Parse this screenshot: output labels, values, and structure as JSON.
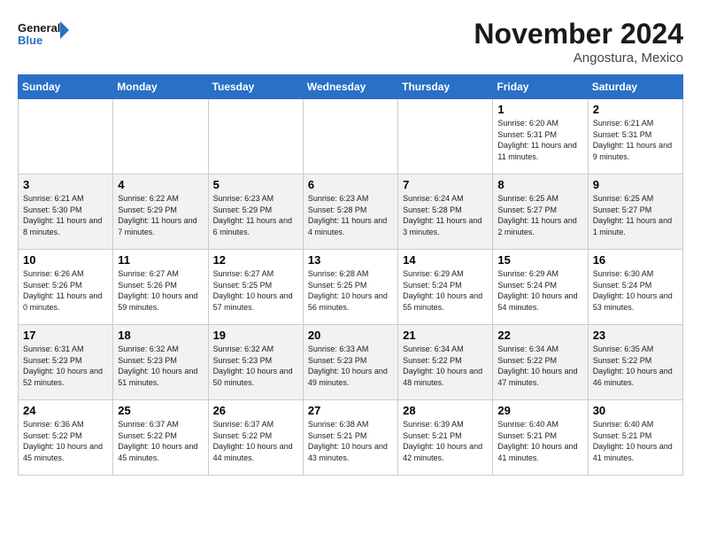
{
  "logo": {
    "line1": "General",
    "line2": "Blue"
  },
  "title": "November 2024",
  "location": "Angostura, Mexico",
  "days_of_week": [
    "Sunday",
    "Monday",
    "Tuesday",
    "Wednesday",
    "Thursday",
    "Friday",
    "Saturday"
  ],
  "weeks": [
    [
      {
        "day": "",
        "info": ""
      },
      {
        "day": "",
        "info": ""
      },
      {
        "day": "",
        "info": ""
      },
      {
        "day": "",
        "info": ""
      },
      {
        "day": "",
        "info": ""
      },
      {
        "day": "1",
        "info": "Sunrise: 6:20 AM\nSunset: 5:31 PM\nDaylight: 11 hours and 11 minutes."
      },
      {
        "day": "2",
        "info": "Sunrise: 6:21 AM\nSunset: 5:31 PM\nDaylight: 11 hours and 9 minutes."
      }
    ],
    [
      {
        "day": "3",
        "info": "Sunrise: 6:21 AM\nSunset: 5:30 PM\nDaylight: 11 hours and 8 minutes."
      },
      {
        "day": "4",
        "info": "Sunrise: 6:22 AM\nSunset: 5:29 PM\nDaylight: 11 hours and 7 minutes."
      },
      {
        "day": "5",
        "info": "Sunrise: 6:23 AM\nSunset: 5:29 PM\nDaylight: 11 hours and 6 minutes."
      },
      {
        "day": "6",
        "info": "Sunrise: 6:23 AM\nSunset: 5:28 PM\nDaylight: 11 hours and 4 minutes."
      },
      {
        "day": "7",
        "info": "Sunrise: 6:24 AM\nSunset: 5:28 PM\nDaylight: 11 hours and 3 minutes."
      },
      {
        "day": "8",
        "info": "Sunrise: 6:25 AM\nSunset: 5:27 PM\nDaylight: 11 hours and 2 minutes."
      },
      {
        "day": "9",
        "info": "Sunrise: 6:25 AM\nSunset: 5:27 PM\nDaylight: 11 hours and 1 minute."
      }
    ],
    [
      {
        "day": "10",
        "info": "Sunrise: 6:26 AM\nSunset: 5:26 PM\nDaylight: 11 hours and 0 minutes."
      },
      {
        "day": "11",
        "info": "Sunrise: 6:27 AM\nSunset: 5:26 PM\nDaylight: 10 hours and 59 minutes."
      },
      {
        "day": "12",
        "info": "Sunrise: 6:27 AM\nSunset: 5:25 PM\nDaylight: 10 hours and 57 minutes."
      },
      {
        "day": "13",
        "info": "Sunrise: 6:28 AM\nSunset: 5:25 PM\nDaylight: 10 hours and 56 minutes."
      },
      {
        "day": "14",
        "info": "Sunrise: 6:29 AM\nSunset: 5:24 PM\nDaylight: 10 hours and 55 minutes."
      },
      {
        "day": "15",
        "info": "Sunrise: 6:29 AM\nSunset: 5:24 PM\nDaylight: 10 hours and 54 minutes."
      },
      {
        "day": "16",
        "info": "Sunrise: 6:30 AM\nSunset: 5:24 PM\nDaylight: 10 hours and 53 minutes."
      }
    ],
    [
      {
        "day": "17",
        "info": "Sunrise: 6:31 AM\nSunset: 5:23 PM\nDaylight: 10 hours and 52 minutes."
      },
      {
        "day": "18",
        "info": "Sunrise: 6:32 AM\nSunset: 5:23 PM\nDaylight: 10 hours and 51 minutes."
      },
      {
        "day": "19",
        "info": "Sunrise: 6:32 AM\nSunset: 5:23 PM\nDaylight: 10 hours and 50 minutes."
      },
      {
        "day": "20",
        "info": "Sunrise: 6:33 AM\nSunset: 5:23 PM\nDaylight: 10 hours and 49 minutes."
      },
      {
        "day": "21",
        "info": "Sunrise: 6:34 AM\nSunset: 5:22 PM\nDaylight: 10 hours and 48 minutes."
      },
      {
        "day": "22",
        "info": "Sunrise: 6:34 AM\nSunset: 5:22 PM\nDaylight: 10 hours and 47 minutes."
      },
      {
        "day": "23",
        "info": "Sunrise: 6:35 AM\nSunset: 5:22 PM\nDaylight: 10 hours and 46 minutes."
      }
    ],
    [
      {
        "day": "24",
        "info": "Sunrise: 6:36 AM\nSunset: 5:22 PM\nDaylight: 10 hours and 45 minutes."
      },
      {
        "day": "25",
        "info": "Sunrise: 6:37 AM\nSunset: 5:22 PM\nDaylight: 10 hours and 45 minutes."
      },
      {
        "day": "26",
        "info": "Sunrise: 6:37 AM\nSunset: 5:22 PM\nDaylight: 10 hours and 44 minutes."
      },
      {
        "day": "27",
        "info": "Sunrise: 6:38 AM\nSunset: 5:21 PM\nDaylight: 10 hours and 43 minutes."
      },
      {
        "day": "28",
        "info": "Sunrise: 6:39 AM\nSunset: 5:21 PM\nDaylight: 10 hours and 42 minutes."
      },
      {
        "day": "29",
        "info": "Sunrise: 6:40 AM\nSunset: 5:21 PM\nDaylight: 10 hours and 41 minutes."
      },
      {
        "day": "30",
        "info": "Sunrise: 6:40 AM\nSunset: 5:21 PM\nDaylight: 10 hours and 41 minutes."
      }
    ]
  ]
}
